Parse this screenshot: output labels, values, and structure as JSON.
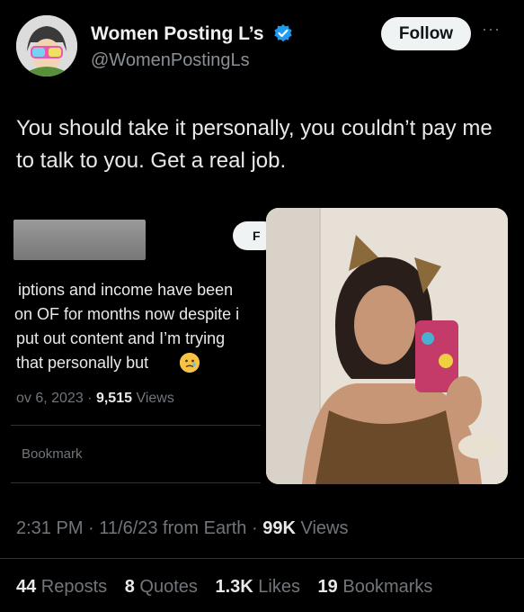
{
  "header": {
    "display_name": "Women Posting L’s",
    "handle": "@WomenPostingLs",
    "follow_label": "Follow",
    "more_label": "···",
    "verified_icon": "verified-badge-icon",
    "accent": "#1d9bf0"
  },
  "tweet": {
    "text": "You should take it personally, you couldn’t pay me to talk to you. Get a real job."
  },
  "quoted_screenshot": {
    "follow_label": "F",
    "lines": [
      "iptions and income have been",
      "on OF for months now despite i",
      "put out content and I’m trying",
      "that personally but"
    ],
    "date": "ov 6, 2023 · ",
    "views_count": "9,515",
    "views_label": " Views",
    "bookmark_label": "Bookmark",
    "emoji_icon": "crying-face-emoji-icon"
  },
  "meta": {
    "time": "2:31 PM · 11/6/23 from Earth · ",
    "views_count": "99K",
    "views_label": " Views"
  },
  "stats": {
    "reposts_count": "44",
    "reposts_label": " Reposts",
    "quotes_count": "8",
    "quotes_label": " Quotes",
    "likes_count": "1.3K",
    "likes_label": " Likes",
    "bookmarks_count": "19",
    "bookmarks_label": " Bookmarks"
  }
}
